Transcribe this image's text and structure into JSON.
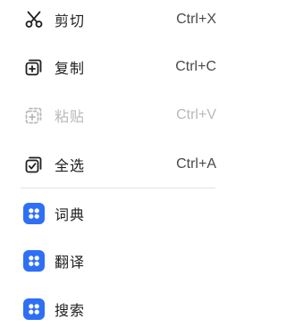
{
  "menu": {
    "edit_items": [
      {
        "label": "剪切",
        "shortcut": "Ctrl+X",
        "icon": "scissors-icon",
        "enabled": true
      },
      {
        "label": "复制",
        "shortcut": "Ctrl+C",
        "icon": "copy-icon",
        "enabled": true
      },
      {
        "label": "粘贴",
        "shortcut": "Ctrl+V",
        "icon": "paste-icon",
        "enabled": false
      },
      {
        "label": "全选",
        "shortcut": "Ctrl+A",
        "icon": "select-all-icon",
        "enabled": true
      }
    ],
    "app_items": [
      {
        "label": "词典",
        "icon": "app-grid-icon"
      },
      {
        "label": "翻译",
        "icon": "app-grid-icon"
      },
      {
        "label": "搜索",
        "icon": "app-grid-icon"
      }
    ]
  },
  "colors": {
    "text": "#1f1f1f",
    "shortcut_text": "#4a4a4a",
    "disabled": "#b9b9b9",
    "accent": "#2f6ff5",
    "divider": "#e3e3e3"
  }
}
